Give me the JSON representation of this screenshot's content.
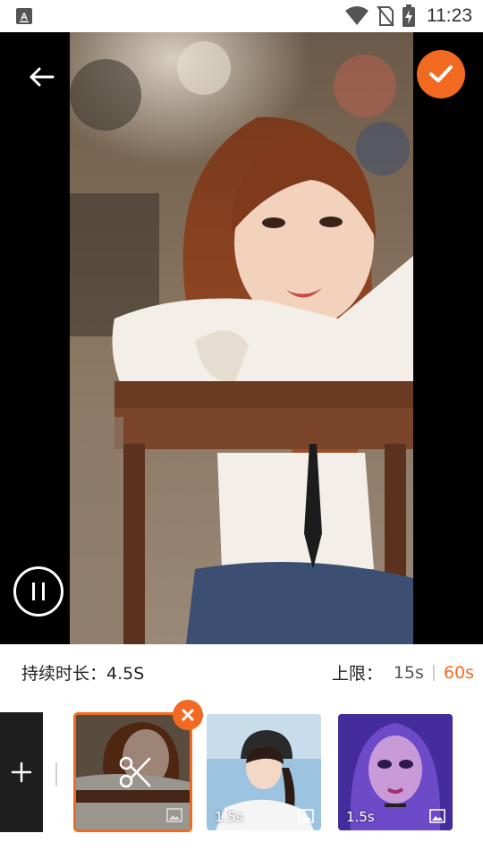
{
  "status_bar": {
    "time": "11:23",
    "icons": [
      "app-notification-icon",
      "wifi-icon",
      "no-sim-icon",
      "battery-charging-icon"
    ]
  },
  "editor": {
    "back_icon": "arrow-left-icon",
    "confirm_icon": "check-icon",
    "pause_icon": "pause-icon"
  },
  "duration": {
    "label": "持续时长：4.5S"
  },
  "limit": {
    "label": "上限：",
    "options": [
      "15s",
      "60s"
    ],
    "selected": "60s"
  },
  "colors": {
    "accent": "#f26a22"
  },
  "clips": [
    {
      "selected": true,
      "icon": "scissors-icon"
    },
    {
      "duration": "1.5s"
    },
    {
      "duration": "1.5s"
    }
  ]
}
